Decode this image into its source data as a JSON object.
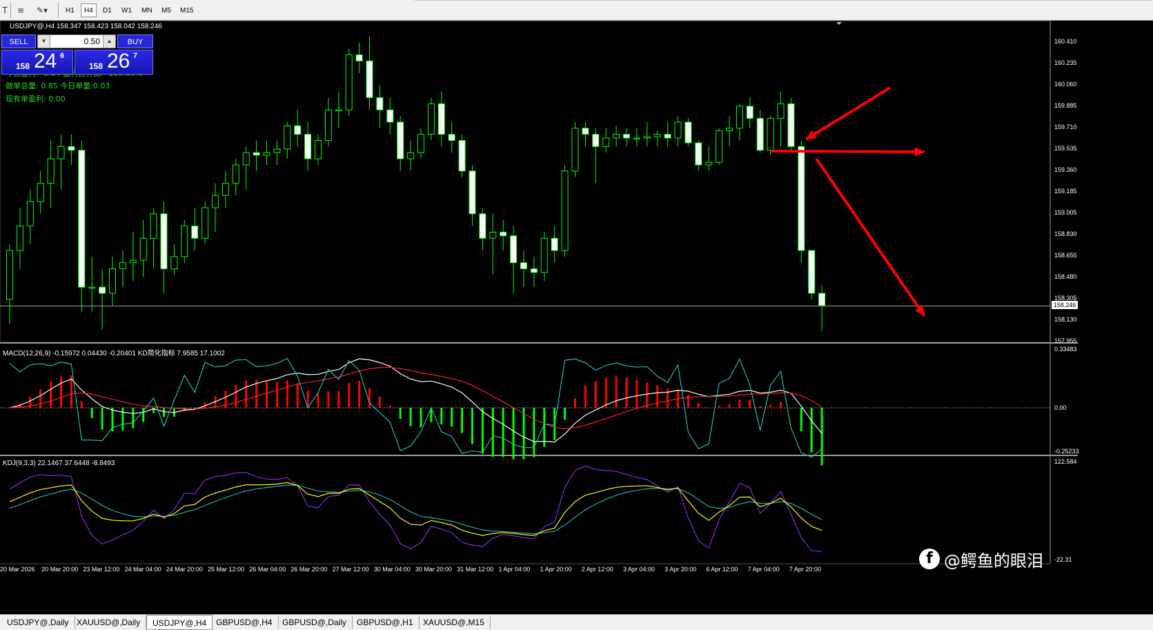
{
  "toolbar": {
    "timeframes": [
      {
        "label": "H1",
        "active": false
      },
      {
        "label": "H4",
        "active": true
      },
      {
        "label": "D1",
        "active": false
      },
      {
        "label": "W1",
        "active": false
      },
      {
        "label": "MN",
        "active": false
      },
      {
        "label": "M5",
        "active": false
      },
      {
        "label": "M15",
        "active": false
      }
    ],
    "icons": [
      "text-tool-icon",
      "fibonacci-tool-icon",
      "shapes-menu-icon"
    ]
  },
  "chart": {
    "header": "USDJPY@,H4  158.347 158.423 158.042 158.246",
    "bid_price": "158.246",
    "price_axis": [
      "160.410",
      "160.235",
      "160.060",
      "159.885",
      "159.710",
      "159.535",
      "159.360",
      "159.185",
      "159.005",
      "158.830",
      "158.655",
      "158.480",
      "158.305",
      "158.130",
      "157.955"
    ],
    "time_axis": [
      "20 Mar 2026",
      "20 Mar 20:00",
      "23 Mar 12:00",
      "24 Mar 04:00",
      "24 Mar 20:00",
      "25 Mar 12:00",
      "26 Mar 04:00",
      "26 Mar 20:00",
      "27 Mar 12:00",
      "30 Mar 04:00",
      "30 Mar 20:00",
      "31 Mar 12:00",
      "1 Apr 04:00",
      "1 Apr 20:00",
      "2 Apr 12:00",
      "3 Apr 04:00",
      "3 Apr 20:00",
      "6 Apr 12:00",
      "7 Apr 04:00",
      "7 Apr 20:00"
    ]
  },
  "trade_panel": {
    "sell_label": "SELL",
    "buy_label": "BUY",
    "lot": "0.50",
    "sell_price_small": "158",
    "sell_price_big": "24",
    "sell_price_sup": "6",
    "buy_price_small": "158",
    "buy_price_big": "26",
    "buy_price_sup": "7"
  },
  "info_lines": {
    "line1": "今日盈利: -0.04   盈利百分比: -100.00%",
    "line2": "做单总量: 0.85    今日单量:0.03",
    "line3": "现有单盈利: 0.00"
  },
  "macd": {
    "header": "MACD(12,26,9) -0.15972 0.04430 -0.20401  KD简化指标 7.9585 17.1002",
    "axis": [
      "0.33483",
      "0.00",
      "-0.25233"
    ]
  },
  "kdj": {
    "header": "KDJ(9,3,3) 22.1467 37.6448 -8.8493",
    "axis": [
      "122.584",
      "-22.31"
    ]
  },
  "watermark": {
    "logo": "f",
    "text": "@鳄鱼的眼泪"
  },
  "tabs": [
    {
      "label": "USDJPY@,Daily",
      "active": false
    },
    {
      "label": "XAUUSD@,Daily",
      "active": false
    },
    {
      "label": "USDJPY@,H4",
      "active": true
    },
    {
      "label": "GBPUSD@,H4",
      "active": false
    },
    {
      "label": "GBPUSD@,Daily",
      "active": false
    },
    {
      "label": "GBPUSD@,H1",
      "active": false
    },
    {
      "label": "XAUUSD@,M15",
      "active": false
    }
  ],
  "colors": {
    "candle_up": "#00ff00",
    "candle_body": "#ffffff",
    "macd_positive": "#ff0000",
    "macd_negative": "#00ff00",
    "annotation_arrow": "#ff0000",
    "kdj_k": "#ffff00",
    "kdj_d": "#20b2aa",
    "kdj_j": "#8a2be2"
  },
  "chart_data": {
    "type": "candlestick",
    "symbol": "USDJPY@",
    "timeframe": "H4",
    "ohlc_last": {
      "open": 158.347,
      "high": 158.423,
      "low": 158.042,
      "close": 158.246
    },
    "ylim": [
      157.955,
      160.41
    ],
    "candles": [
      [
        158.3,
        158.75,
        158.1,
        158.7
      ],
      [
        158.7,
        159.05,
        158.55,
        158.9
      ],
      [
        158.9,
        159.2,
        158.75,
        159.1
      ],
      [
        159.1,
        159.35,
        159.0,
        159.25
      ],
      [
        159.25,
        159.6,
        159.05,
        159.45
      ],
      [
        159.45,
        159.65,
        159.2,
        159.55
      ],
      [
        159.55,
        159.65,
        159.4,
        159.52
      ],
      [
        159.52,
        159.6,
        158.2,
        158.4
      ],
      [
        158.4,
        158.65,
        158.2,
        158.4
      ],
      [
        158.4,
        158.55,
        158.05,
        158.35
      ],
      [
        158.35,
        158.65,
        158.25,
        158.55
      ],
      [
        158.55,
        158.7,
        158.4,
        158.6
      ],
      [
        158.6,
        158.85,
        158.45,
        158.62
      ],
      [
        158.62,
        158.95,
        158.48,
        158.8
      ],
      [
        158.8,
        159.05,
        158.55,
        159.0
      ],
      [
        159.0,
        159.1,
        158.35,
        158.55
      ],
      [
        158.55,
        158.75,
        158.5,
        158.65
      ],
      [
        158.65,
        158.95,
        158.6,
        158.9
      ],
      [
        158.9,
        159.05,
        158.7,
        158.8
      ],
      [
        158.8,
        159.1,
        158.75,
        159.05
      ],
      [
        159.05,
        159.25,
        158.85,
        159.15
      ],
      [
        159.15,
        159.35,
        159.05,
        159.25
      ],
      [
        159.25,
        159.45,
        159.15,
        159.4
      ],
      [
        159.4,
        159.55,
        159.2,
        159.5
      ],
      [
        159.5,
        159.6,
        159.35,
        159.48
      ],
      [
        159.48,
        159.6,
        159.4,
        159.5
      ],
      [
        159.5,
        159.6,
        159.4,
        159.53
      ],
      [
        159.53,
        159.75,
        159.45,
        159.72
      ],
      [
        159.72,
        159.85,
        159.55,
        159.65
      ],
      [
        159.65,
        159.75,
        159.35,
        159.45
      ],
      [
        159.45,
        159.65,
        159.4,
        159.6
      ],
      [
        159.6,
        159.95,
        159.55,
        159.85
      ],
      [
        159.85,
        160.0,
        159.7,
        159.85
      ],
      [
        159.85,
        160.35,
        159.8,
        160.3
      ],
      [
        160.3,
        160.4,
        160.15,
        160.25
      ],
      [
        160.25,
        160.45,
        159.85,
        159.95
      ],
      [
        159.95,
        160.05,
        159.7,
        159.85
      ],
      [
        159.85,
        159.95,
        159.65,
        159.75
      ],
      [
        159.75,
        159.8,
        159.35,
        159.45
      ],
      [
        159.45,
        159.6,
        159.35,
        159.5
      ],
      [
        159.5,
        159.7,
        159.45,
        159.65
      ],
      [
        159.65,
        159.95,
        159.6,
        159.9
      ],
      [
        159.9,
        160.0,
        159.55,
        159.65
      ],
      [
        159.65,
        159.75,
        159.5,
        159.6
      ],
      [
        159.6,
        159.65,
        159.3,
        159.35
      ],
      [
        159.35,
        159.4,
        158.9,
        159.0
      ],
      [
        159.0,
        159.05,
        158.7,
        158.8
      ],
      [
        158.8,
        159.0,
        158.5,
        158.85
      ],
      [
        158.85,
        158.95,
        158.7,
        158.82
      ],
      [
        158.82,
        158.9,
        158.35,
        158.6
      ],
      [
        158.6,
        158.7,
        158.4,
        158.55
      ],
      [
        158.55,
        158.65,
        158.4,
        158.52
      ],
      [
        158.52,
        158.85,
        158.45,
        158.8
      ],
      [
        158.8,
        158.9,
        158.6,
        158.7
      ],
      [
        158.7,
        159.4,
        158.65,
        159.35
      ],
      [
        159.35,
        159.75,
        159.3,
        159.7
      ],
      [
        159.7,
        159.75,
        159.55,
        159.65
      ],
      [
        159.65,
        159.7,
        159.25,
        159.55
      ],
      [
        159.55,
        159.7,
        159.5,
        159.62
      ],
      [
        159.62,
        159.72,
        159.55,
        159.65
      ],
      [
        159.65,
        159.7,
        159.55,
        159.62
      ],
      [
        159.62,
        159.7,
        159.55,
        159.62
      ],
      [
        159.62,
        159.75,
        159.55,
        159.63
      ],
      [
        159.63,
        159.68,
        159.55,
        159.65
      ],
      [
        159.65,
        159.75,
        159.55,
        159.62
      ],
      [
        159.62,
        159.8,
        159.55,
        159.75
      ],
      [
        159.75,
        159.78,
        159.55,
        159.58
      ],
      [
        159.58,
        159.6,
        159.35,
        159.4
      ],
      [
        159.4,
        159.55,
        159.35,
        159.42
      ],
      [
        159.42,
        159.7,
        159.4,
        159.68
      ],
      [
        159.68,
        159.8,
        159.55,
        159.7
      ],
      [
        159.7,
        159.9,
        159.6,
        159.88
      ],
      [
        159.88,
        159.95,
        159.7,
        159.78
      ],
      [
        159.78,
        159.85,
        159.5,
        159.52
      ],
      [
        159.52,
        159.8,
        159.48,
        159.78
      ],
      [
        159.78,
        160.0,
        159.55,
        159.9
      ],
      [
        159.9,
        159.95,
        159.5,
        159.55
      ],
      [
        159.55,
        159.6,
        158.6,
        158.7
      ],
      [
        158.7,
        158.7,
        158.3,
        158.35
      ],
      [
        158.35,
        158.42,
        158.04,
        158.25
      ]
    ]
  }
}
